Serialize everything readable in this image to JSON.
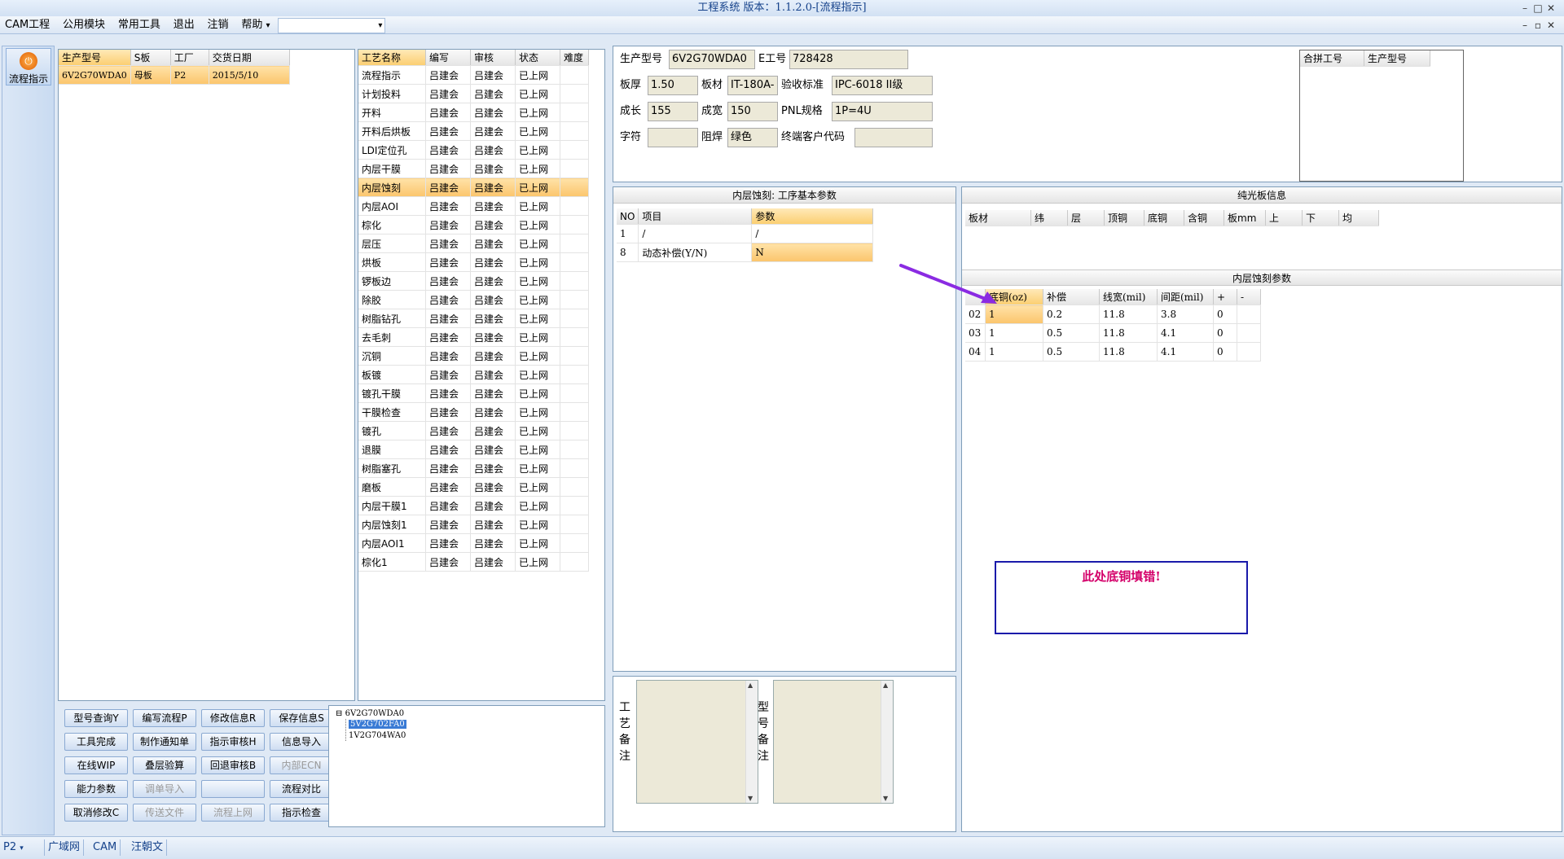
{
  "window": {
    "title": "工程系统 版本：1.1.2.0-[流程指示]",
    "controls": [
      "–",
      "□",
      "✕"
    ],
    "mdi_controls": [
      "–",
      "▫",
      "✕"
    ]
  },
  "menu": {
    "items": [
      "CAM工程",
      "公用模块",
      "常用工具",
      "退出",
      "注销",
      "帮助"
    ],
    "help_arrow": "▾",
    "combo_value": ""
  },
  "nav": {
    "flow_button": "流程指示",
    "flow_icon": "⏻"
  },
  "orders": {
    "columns": [
      "生产型号",
      "S板",
      "工厂",
      "交货日期"
    ],
    "rows": [
      [
        "6V2G70WDA0",
        "母板",
        "P2",
        "2015/5/10"
      ]
    ]
  },
  "process": {
    "columns": [
      "工艺名称",
      "编写",
      "审核",
      "状态",
      "难度"
    ],
    "rows": [
      [
        "流程指示",
        "吕建会",
        "吕建会",
        "已上网",
        ""
      ],
      [
        "计划投料",
        "吕建会",
        "吕建会",
        "已上网",
        ""
      ],
      [
        "开料",
        "吕建会",
        "吕建会",
        "已上网",
        ""
      ],
      [
        "开料后烘板",
        "吕建会",
        "吕建会",
        "已上网",
        ""
      ],
      [
        "LDI定位孔",
        "吕建会",
        "吕建会",
        "已上网",
        ""
      ],
      [
        "内层干膜",
        "吕建会",
        "吕建会",
        "已上网",
        ""
      ],
      [
        "内层蚀刻",
        "吕建会",
        "吕建会",
        "已上网",
        ""
      ],
      [
        "内层AOI",
        "吕建会",
        "吕建会",
        "已上网",
        ""
      ],
      [
        "棕化",
        "吕建会",
        "吕建会",
        "已上网",
        ""
      ],
      [
        "层压",
        "吕建会",
        "吕建会",
        "已上网",
        ""
      ],
      [
        "烘板",
        "吕建会",
        "吕建会",
        "已上网",
        ""
      ],
      [
        "锣板边",
        "吕建会",
        "吕建会",
        "已上网",
        ""
      ],
      [
        "除胶",
        "吕建会",
        "吕建会",
        "已上网",
        ""
      ],
      [
        "树脂钻孔",
        "吕建会",
        "吕建会",
        "已上网",
        ""
      ],
      [
        "去毛刺",
        "吕建会",
        "吕建会",
        "已上网",
        ""
      ],
      [
        "沉铜",
        "吕建会",
        "吕建会",
        "已上网",
        ""
      ],
      [
        "板镀",
        "吕建会",
        "吕建会",
        "已上网",
        ""
      ],
      [
        "镀孔干膜",
        "吕建会",
        "吕建会",
        "已上网",
        ""
      ],
      [
        "干膜检查",
        "吕建会",
        "吕建会",
        "已上网",
        ""
      ],
      [
        "镀孔",
        "吕建会",
        "吕建会",
        "已上网",
        ""
      ],
      [
        "退膜",
        "吕建会",
        "吕建会",
        "已上网",
        ""
      ],
      [
        "树脂塞孔",
        "吕建会",
        "吕建会",
        "已上网",
        ""
      ],
      [
        "磨板",
        "吕建会",
        "吕建会",
        "已上网",
        ""
      ],
      [
        "内层干膜1",
        "吕建会",
        "吕建会",
        "已上网",
        ""
      ],
      [
        "内层蚀刻1",
        "吕建会",
        "吕建会",
        "已上网",
        ""
      ],
      [
        "内层AOI1",
        "吕建会",
        "吕建会",
        "已上网",
        ""
      ],
      [
        "棕化1",
        "吕建会",
        "吕建会",
        "已上网",
        ""
      ]
    ],
    "selected_index": 6
  },
  "buttons": [
    [
      "型号查询Y",
      "编写流程P",
      "修改信息R",
      "保存信息S"
    ],
    [
      "工具完成",
      "制作通知单",
      "指示审核H",
      "信息导入"
    ],
    [
      "在线WIP",
      "叠层验算",
      "回退审核B",
      "内部ECN"
    ],
    [
      "能力参数",
      "调单导入",
      "",
      "流程对比"
    ],
    [
      "取消修改C",
      "传送文件",
      "流程上网",
      "指示检查"
    ]
  ],
  "disabled_buttons": [
    "内部ECN",
    "调单导入",
    "传送文件",
    "流程上网"
  ],
  "tree": {
    "root": "6V2G70WDA0",
    "expander": "⊟",
    "children": [
      "5V2G702FA0",
      "1V2G704WA0"
    ]
  },
  "info": {
    "model_label": "生产型号",
    "model_value": "6V2G70WDA0",
    "eno_label": "E工号",
    "eno_value": "728428",
    "thick_label": "板厚",
    "thick_value": "1.50",
    "material_label": "板材",
    "material_value": "IT-180A-",
    "std_label": "验收标准",
    "std_value": "IPC-6018 II级",
    "len_label": "成长",
    "len_value": "155",
    "wid_label": "成宽",
    "wid_value": "150",
    "pnl_label": "PNL规格",
    "pnl_value": "1P=4U",
    "char_label": "字符",
    "char_value": "",
    "mask_label": "阻焊",
    "mask_value": "绿色",
    "cust_label": "终端客户代码",
    "cust_value": ""
  },
  "combine": {
    "columns": [
      "合拼工号",
      "生产型号"
    ]
  },
  "basic_params": {
    "title": "内层蚀刻: 工序基本参数",
    "columns": [
      "NO",
      "项目",
      "参数"
    ],
    "rows": [
      [
        "1",
        "/",
        "/"
      ],
      [
        "8",
        "动态补偿(Y/N)",
        "N"
      ]
    ]
  },
  "bare_board": {
    "title": "纯光板信息",
    "columns": [
      "板材",
      "纬",
      "层",
      "顶铜",
      "底铜",
      "含铜",
      "板mm",
      "上",
      "下",
      "均"
    ]
  },
  "etch_params": {
    "title": "内层蚀刻参数",
    "columns": [
      "",
      "底铜(oz)",
      "补偿",
      "线宽(mil)",
      "间距(mil)",
      "+",
      "-"
    ],
    "rows": [
      [
        "02",
        "1",
        "0.2",
        "11.8",
        "3.8",
        "0",
        ""
      ],
      [
        "03",
        "1",
        "0.5",
        "11.8",
        "4.1",
        "0",
        ""
      ],
      [
        "04",
        "1",
        "0.5",
        "11.8",
        "4.1",
        "0",
        ""
      ]
    ]
  },
  "annotation": {
    "text": "此处底铜填错!",
    "color": "#d4006a",
    "arrow_color": "#8a2be2"
  },
  "remarks": {
    "process_label": [
      "工",
      "艺",
      "备",
      "注"
    ],
    "model_label": [
      "型",
      "号",
      "备",
      "注"
    ]
  },
  "statusbar": {
    "combo": "P2",
    "tabs": [
      "广域网",
      "CAM",
      "汪朝文"
    ]
  },
  "colors": {
    "accent": "#15428b",
    "selection": "#fbc56c"
  }
}
